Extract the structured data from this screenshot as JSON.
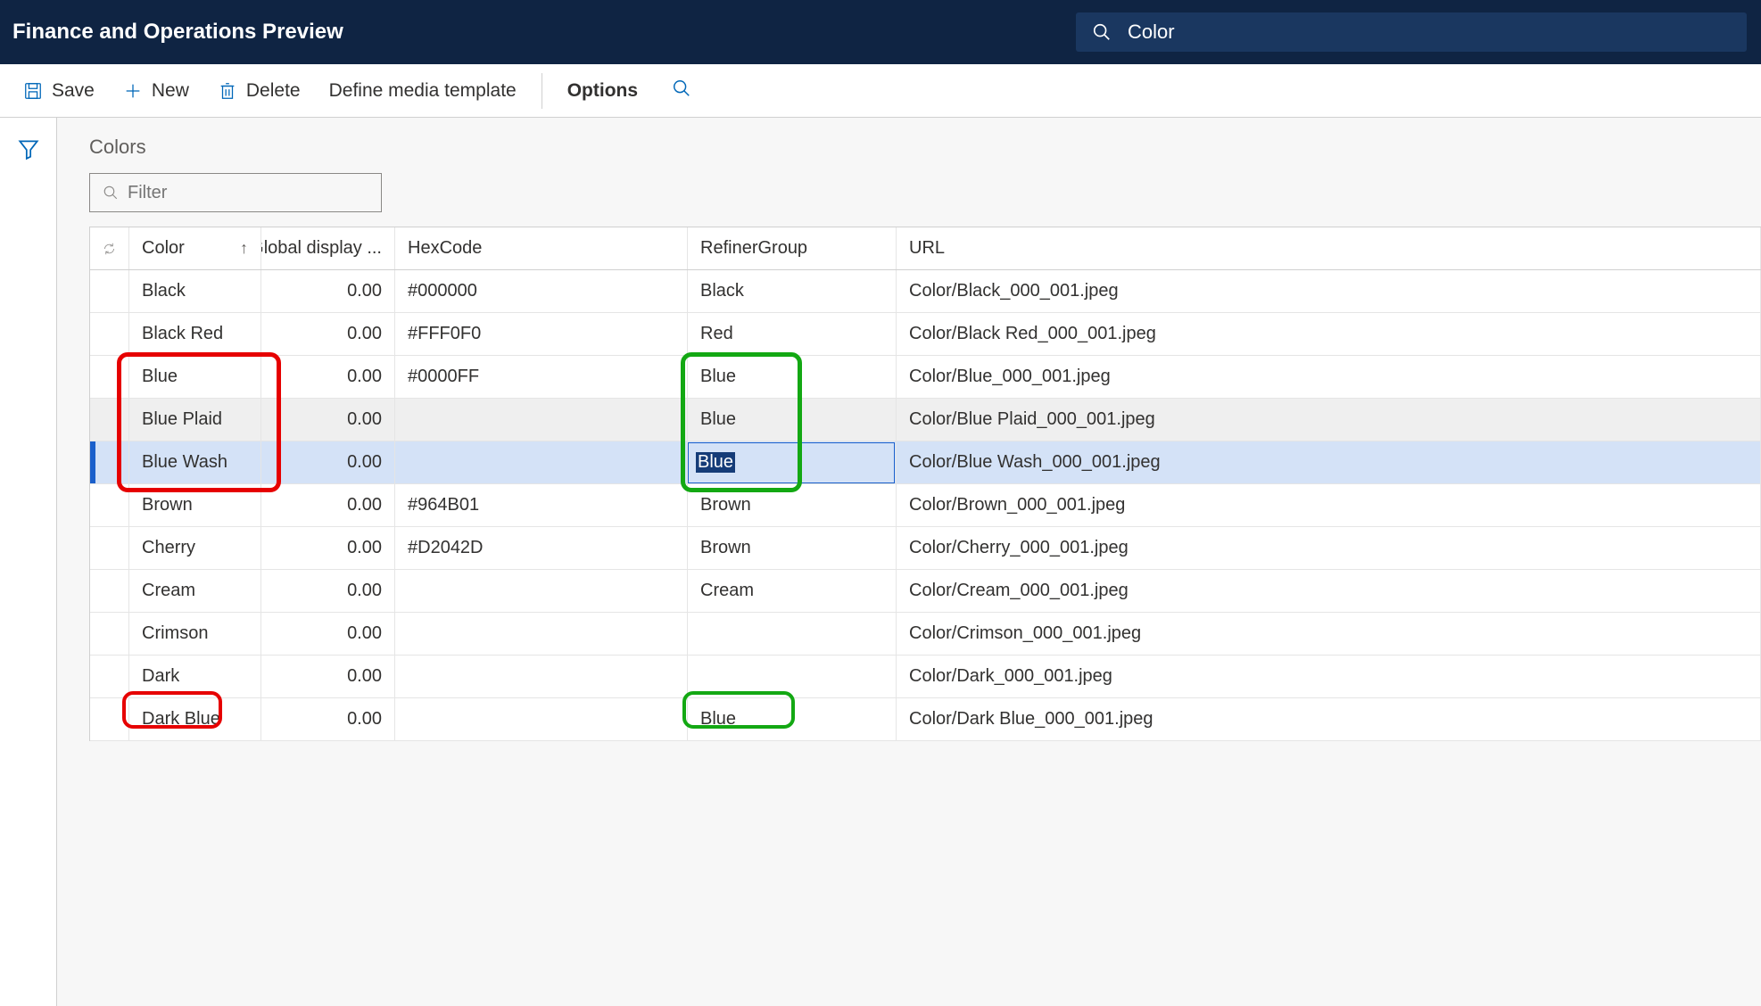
{
  "header": {
    "title": "Finance and Operations Preview"
  },
  "search": {
    "value": "Color"
  },
  "actions": {
    "save": "Save",
    "new": "New",
    "delete": "Delete",
    "define_media": "Define media template",
    "options": "Options"
  },
  "page": {
    "title": "Colors",
    "filter_placeholder": "Filter"
  },
  "grid": {
    "columns": {
      "color": "Color",
      "global_display": "Global display ...",
      "hex": "HexCode",
      "refiner": "RefinerGroup",
      "url": "URL"
    },
    "rows": [
      {
        "color": "Black",
        "disp": "0.00",
        "hex": "#000000",
        "refiner": "Black",
        "url": "Color/Black_000_001.jpeg"
      },
      {
        "color": "Black Red",
        "disp": "0.00",
        "hex": "#FFF0F0",
        "refiner": "Red",
        "url": "Color/Black Red_000_001.jpeg"
      },
      {
        "color": "Blue",
        "disp": "0.00",
        "hex": "#0000FF",
        "refiner": "Blue",
        "url": "Color/Blue_000_001.jpeg"
      },
      {
        "color": "Blue Plaid",
        "disp": "0.00",
        "hex": "",
        "refiner": "Blue",
        "url": "Color/Blue Plaid_000_001.jpeg"
      },
      {
        "color": "Blue Wash",
        "disp": "0.00",
        "hex": "",
        "refiner": "Blue",
        "url": "Color/Blue Wash_000_001.jpeg"
      },
      {
        "color": "Brown",
        "disp": "0.00",
        "hex": "#964B01",
        "refiner": "Brown",
        "url": "Color/Brown_000_001.jpeg"
      },
      {
        "color": "Cherry",
        "disp": "0.00",
        "hex": "#D2042D",
        "refiner": "Brown",
        "url": "Color/Cherry_000_001.jpeg"
      },
      {
        "color": "Cream",
        "disp": "0.00",
        "hex": "",
        "refiner": "Cream",
        "url": "Color/Cream_000_001.jpeg"
      },
      {
        "color": "Crimson",
        "disp": "0.00",
        "hex": "",
        "refiner": "",
        "url": "Color/Crimson_000_001.jpeg"
      },
      {
        "color": "Dark",
        "disp": "0.00",
        "hex": "",
        "refiner": "",
        "url": "Color/Dark_000_001.jpeg"
      },
      {
        "color": "Dark Blue",
        "disp": "0.00",
        "hex": "",
        "refiner": "Blue",
        "url": "Color/Dark Blue_000_001.jpeg"
      }
    ],
    "state": {
      "selected_index": 4,
      "alt_index": 3,
      "sort_column": "color",
      "sort_dir": "asc"
    }
  }
}
